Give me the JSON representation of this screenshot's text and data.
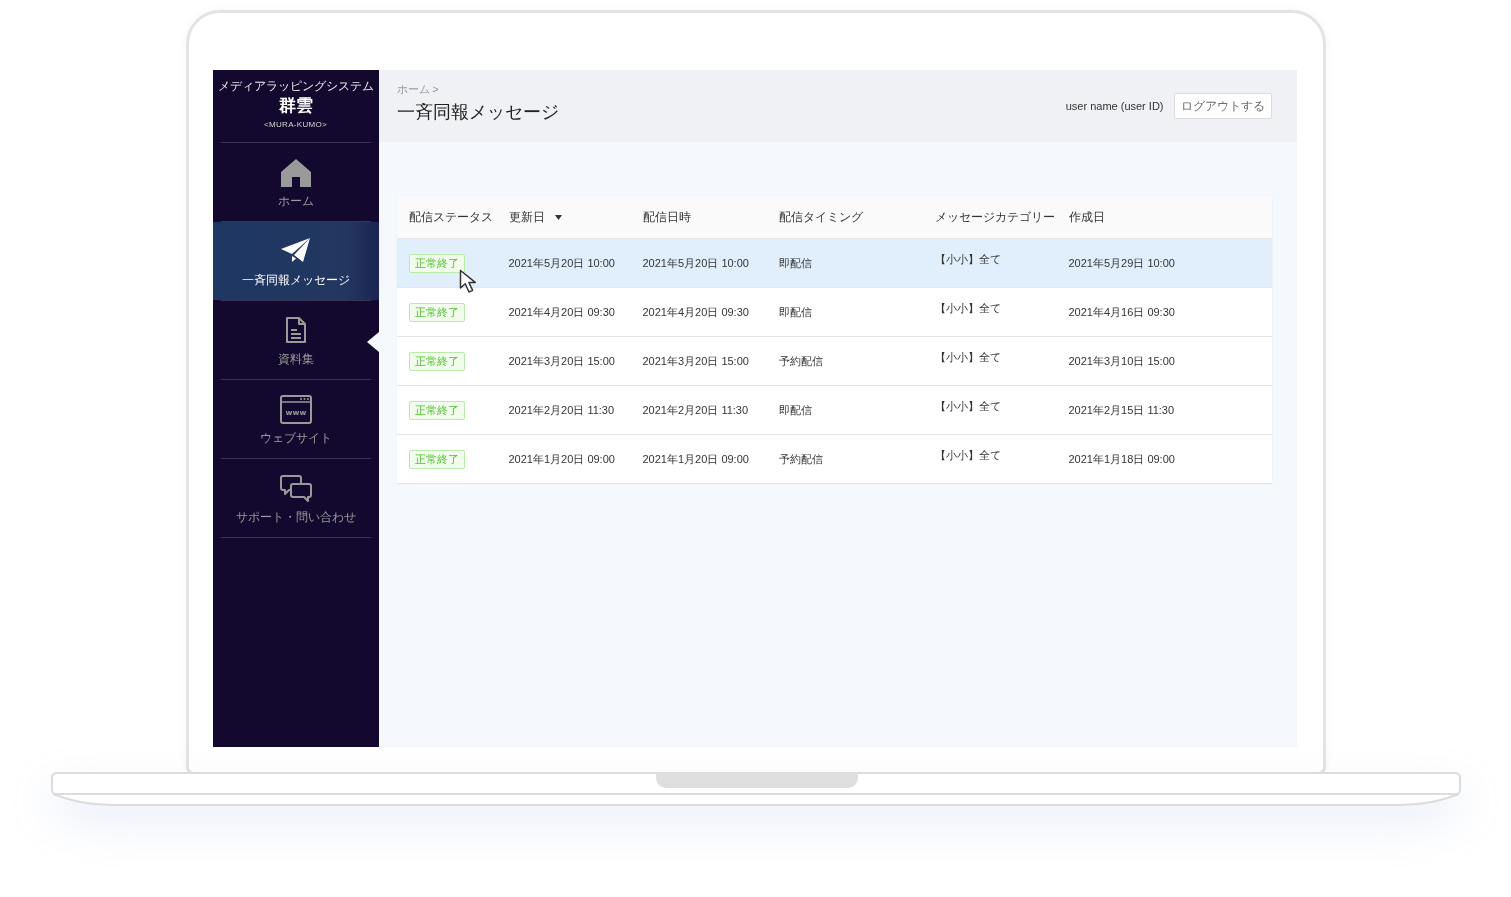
{
  "sidebar": {
    "system_name": "メディアラッピングシステム",
    "logo": "群雲",
    "logo_reading": "<MURA-KUMO>",
    "items": [
      {
        "label": "ホーム",
        "selected": false
      },
      {
        "label": "一斉同報メッセージ",
        "selected": true
      },
      {
        "label": "資料集",
        "selected": false
      },
      {
        "label": "ウェブサイト",
        "selected": false,
        "icon_text": "www"
      },
      {
        "label": "サポート・問い合わせ",
        "selected": false
      }
    ]
  },
  "header": {
    "breadcrumb": "ホーム >",
    "title": "一斉同報メッセージ",
    "user": "user name (user ID)",
    "logout_button": "ログアウトする"
  },
  "table": {
    "columns": [
      {
        "label": "配信ステータス",
        "sorted": false
      },
      {
        "label": "更新日",
        "sorted": true
      },
      {
        "label": "配信日時",
        "sorted": false
      },
      {
        "label": "配信タイミング",
        "sorted": false
      },
      {
        "label": "メッセージカテゴリー",
        "sorted": false
      },
      {
        "label": "作成日",
        "sorted": false
      }
    ],
    "rows": [
      {
        "selected": true,
        "status": "正常終了",
        "updated": "2021年5月20日 10:00",
        "delivered_at": "2021年5月20日 10:00",
        "timing": "即配信",
        "category": "【小小】全て",
        "created": "2021年5月29日 10:00"
      },
      {
        "selected": false,
        "status": "正常終了",
        "updated": "2021年4月20日 09:30",
        "delivered_at": "2021年4月20日 09:30",
        "timing": "即配信",
        "category": "【小小】全て",
        "created": "2021年4月16日 09:30"
      },
      {
        "selected": false,
        "status": "正常終了",
        "updated": "2021年3月20日 15:00",
        "delivered_at": "2021年3月20日 15:00",
        "timing": "予約配信",
        "category": "【小小】全て",
        "created": "2021年3月10日 15:00"
      },
      {
        "selected": false,
        "status": "正常終了",
        "updated": "2021年2月20日 11:30",
        "delivered_at": "2021年2月20日 11:30",
        "timing": "即配信",
        "category": "【小小】全て",
        "created": "2021年2月15日 11:30"
      },
      {
        "selected": false,
        "status": "正常終了",
        "updated": "2021年1月20日 09:00",
        "delivered_at": "2021年1月20日 09:00",
        "timing": "予約配信",
        "category": "【小小】全て",
        "created": "2021年1月18日 09:00"
      }
    ]
  }
}
